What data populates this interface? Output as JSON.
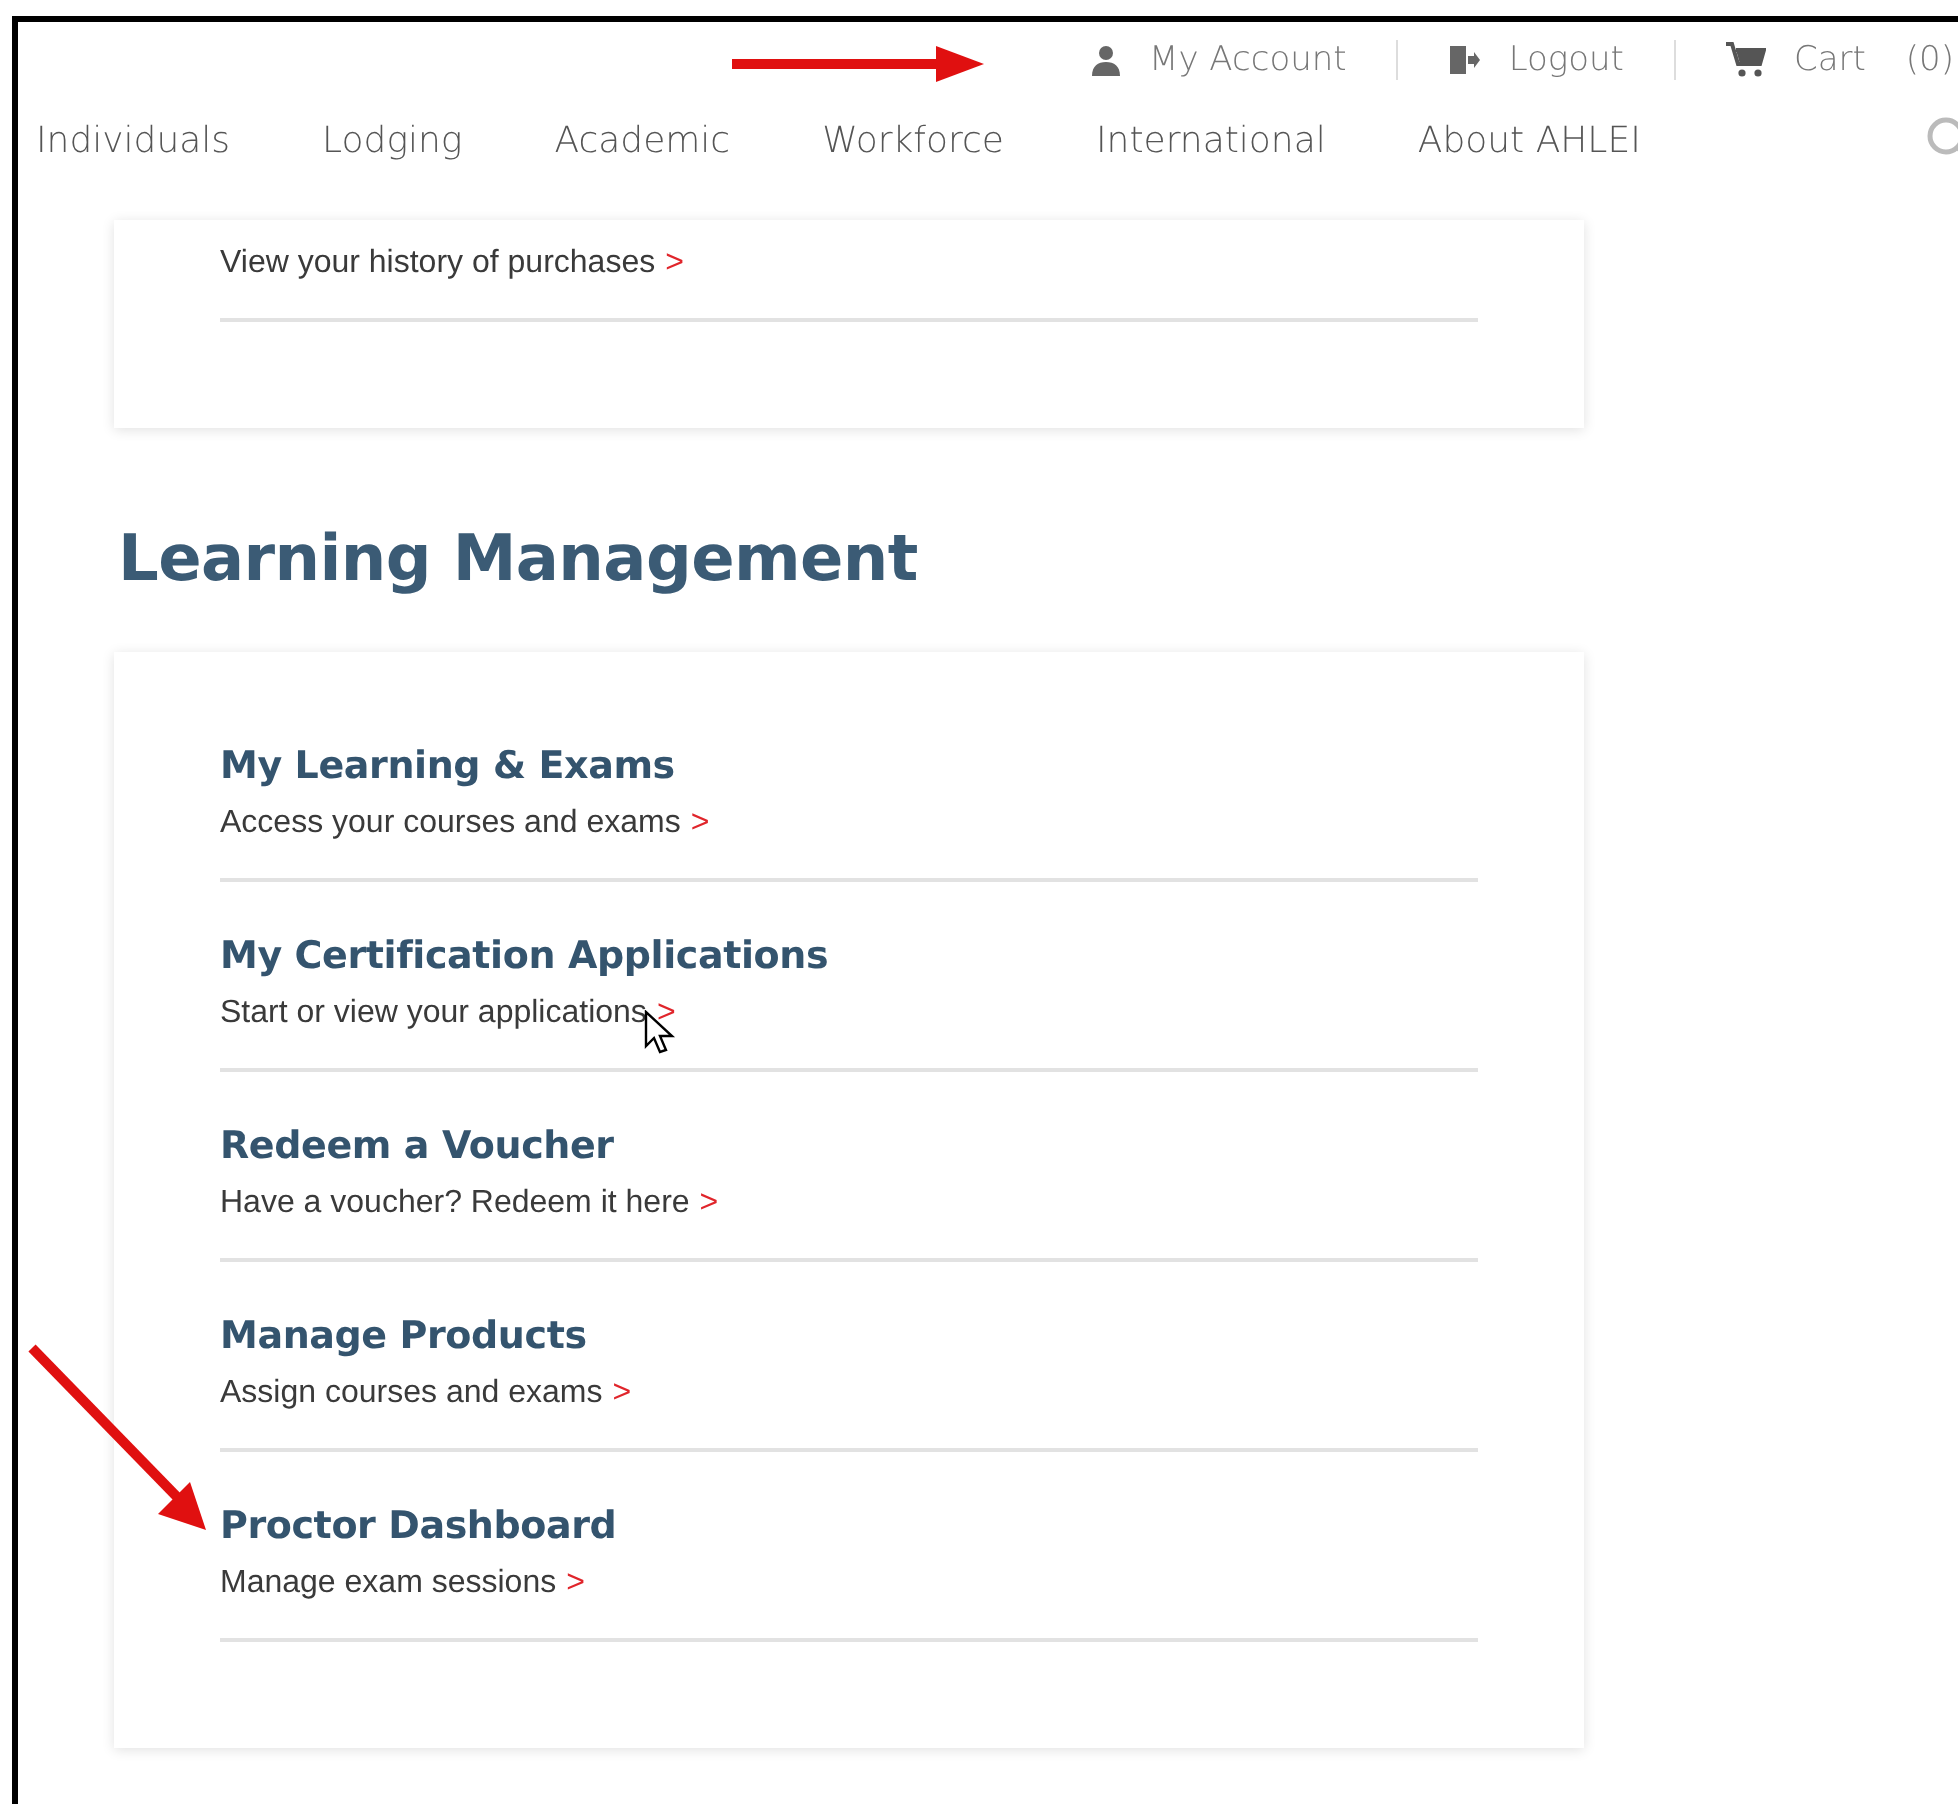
{
  "top_links": [
    {
      "kind": "account",
      "label": "My Account"
    },
    {
      "kind": "logout",
      "label": "Logout"
    },
    {
      "kind": "cart",
      "label": "Cart",
      "count": "(0)"
    }
  ],
  "nav": [
    "Individuals",
    "Lodging",
    "Academic",
    "Workforce",
    "International",
    "About AHLEI"
  ],
  "sections": [
    {
      "items": [
        {
          "description": "View your history of purchases",
          "link": ">"
        }
      ]
    },
    {
      "heading": "Learning Management",
      "items": [
        {
          "title": "My Learning & Exams",
          "description": "Access your courses and exams",
          "link": ">"
        },
        {
          "title": "My Certification Applications",
          "description": "Start or view your applications",
          "link": ">"
        },
        {
          "title": "Redeem a Voucher",
          "description": "Have a voucher? Redeem it here",
          "link": ">"
        },
        {
          "title": "Manage Products",
          "description": "Assign courses and exams",
          "link": ">"
        },
        {
          "title": "Proctor Dashboard",
          "description": "Manage exam sessions",
          "link": ">"
        }
      ]
    }
  ]
}
